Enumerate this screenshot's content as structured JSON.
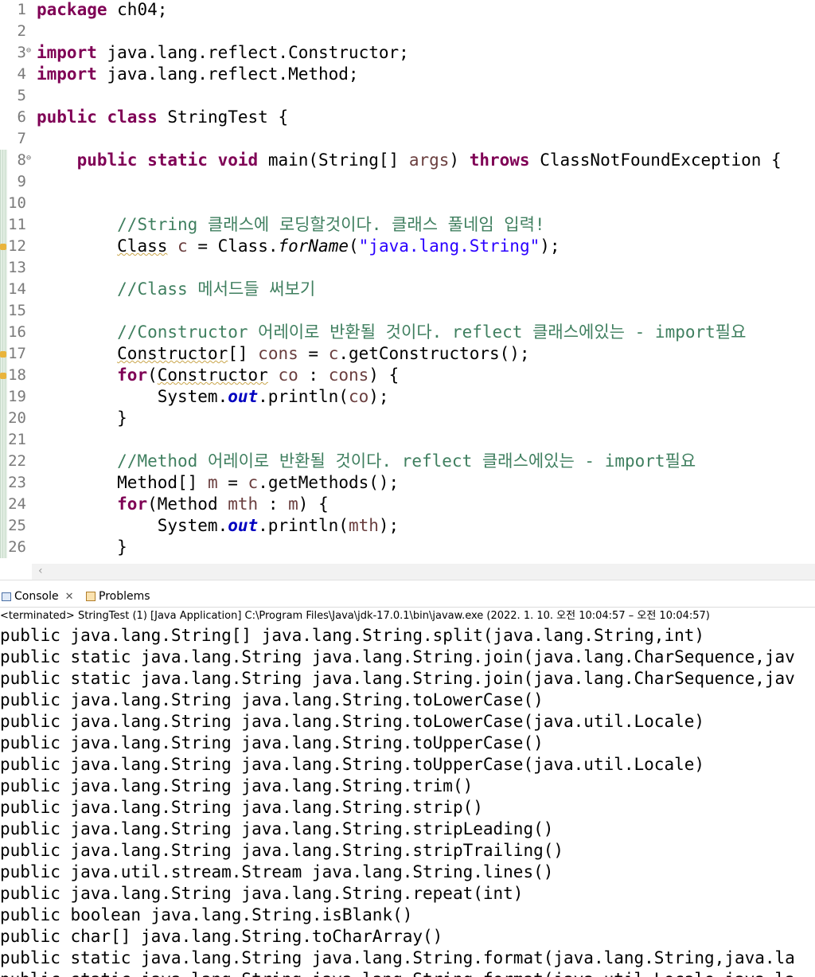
{
  "editor": {
    "line_numbers": [
      "1",
      "2",
      "3",
      "4",
      "5",
      "6",
      "7",
      "8",
      "9",
      "10",
      "11",
      "12",
      "13",
      "14",
      "15",
      "16",
      "17",
      "18",
      "19",
      "20",
      "21",
      "22",
      "23",
      "24",
      "25",
      "26"
    ],
    "lines": [
      [
        {
          "t": "package",
          "c": "kw"
        },
        {
          "t": " ch04;"
        }
      ],
      [],
      [
        {
          "t": "import",
          "c": "kw"
        },
        {
          "t": " java.lang.reflect.Constructor;"
        }
      ],
      [
        {
          "t": "import",
          "c": "kw"
        },
        {
          "t": " java.lang.reflect.Method;"
        }
      ],
      [],
      [
        {
          "t": "public",
          "c": "kw"
        },
        {
          "t": " "
        },
        {
          "t": "class",
          "c": "kw"
        },
        {
          "t": " StringTest {"
        }
      ],
      [],
      [
        {
          "t": "    "
        },
        {
          "t": "public",
          "c": "kw"
        },
        {
          "t": " "
        },
        {
          "t": "static",
          "c": "kw"
        },
        {
          "t": " "
        },
        {
          "t": "void",
          "c": "kw"
        },
        {
          "t": " main(String[] "
        },
        {
          "t": "args",
          "c": "var"
        },
        {
          "t": ") "
        },
        {
          "t": "throws",
          "c": "kw"
        },
        {
          "t": " ClassNotFoundException {"
        }
      ],
      [],
      [],
      [
        {
          "t": "        "
        },
        {
          "t": "//String 클래스에 로딩할것이다. 클래스 풀네임 입력!",
          "c": "cm"
        }
      ],
      [
        {
          "t": "        "
        },
        {
          "t": "Class",
          "c": "squig"
        },
        {
          "t": " "
        },
        {
          "t": "c",
          "c": "var"
        },
        {
          "t": " = Class."
        },
        {
          "t": "forName",
          "c": "sm"
        },
        {
          "t": "("
        },
        {
          "t": "\"java.lang.String\"",
          "c": "st"
        },
        {
          "t": ");"
        }
      ],
      [],
      [
        {
          "t": "        "
        },
        {
          "t": "//Class 메서드들 써보기",
          "c": "cm"
        }
      ],
      [],
      [
        {
          "t": "        "
        },
        {
          "t": "//Constructor 어레이로 반환될 것이다. reflect 클래스에있는 - import필요",
          "c": "cm"
        }
      ],
      [
        {
          "t": "        "
        },
        {
          "t": "Constructor",
          "c": "squig"
        },
        {
          "t": "[] "
        },
        {
          "t": "cons",
          "c": "var"
        },
        {
          "t": " = "
        },
        {
          "t": "c",
          "c": "var"
        },
        {
          "t": ".getConstructors();"
        }
      ],
      [
        {
          "t": "        "
        },
        {
          "t": "for",
          "c": "kw"
        },
        {
          "t": "("
        },
        {
          "t": "Constructor",
          "c": "squig"
        },
        {
          "t": " "
        },
        {
          "t": "co",
          "c": "var"
        },
        {
          "t": " : "
        },
        {
          "t": "cons",
          "c": "var"
        },
        {
          "t": ") {"
        }
      ],
      [
        {
          "t": "            System."
        },
        {
          "t": "out",
          "c": "fld"
        },
        {
          "t": ".println("
        },
        {
          "t": "co",
          "c": "var"
        },
        {
          "t": ");"
        }
      ],
      [
        {
          "t": "        }"
        }
      ],
      [],
      [
        {
          "t": "        "
        },
        {
          "t": "//Method 어레이로 반환될 것이다. reflect 클래스에있는 - import필요",
          "c": "cm"
        }
      ],
      [
        {
          "t": "        Method[] "
        },
        {
          "t": "m",
          "c": "var"
        },
        {
          "t": " = "
        },
        {
          "t": "c",
          "c": "var"
        },
        {
          "t": ".getMethods();"
        }
      ],
      [
        {
          "t": "        "
        },
        {
          "t": "for",
          "c": "kw"
        },
        {
          "t": "(Method "
        },
        {
          "t": "mth",
          "c": "var"
        },
        {
          "t": " : "
        },
        {
          "t": "m",
          "c": "var"
        },
        {
          "t": ") {"
        }
      ],
      [
        {
          "t": "            System."
        },
        {
          "t": "out",
          "c": "fld"
        },
        {
          "t": ".println("
        },
        {
          "t": "mth",
          "c": "var"
        },
        {
          "t": ");"
        }
      ],
      [
        {
          "t": "        }"
        }
      ]
    ]
  },
  "tabs": {
    "console_label": "Console",
    "close_glyph": "✕",
    "problems_label": "Problems"
  },
  "status_text": "<terminated> StringTest (1) [Java Application] C:\\Program Files\\Java\\jdk-17.0.1\\bin\\javaw.exe  (2022. 1. 10. 오전 10:04:57 – 오전 10:04:57)",
  "console_lines": [
    "public java.lang.String[] java.lang.String.split(java.lang.String,int)",
    "public static java.lang.String java.lang.String.join(java.lang.CharSequence,jav",
    "public static java.lang.String java.lang.String.join(java.lang.CharSequence,jav",
    "public java.lang.String java.lang.String.toLowerCase()",
    "public java.lang.String java.lang.String.toLowerCase(java.util.Locale)",
    "public java.lang.String java.lang.String.toUpperCase()",
    "public java.lang.String java.lang.String.toUpperCase(java.util.Locale)",
    "public java.lang.String java.lang.String.trim()",
    "public java.lang.String java.lang.String.strip()",
    "public java.lang.String java.lang.String.stripLeading()",
    "public java.lang.String java.lang.String.stripTrailing()",
    "public java.util.stream.Stream java.lang.String.lines()",
    "public java.lang.String java.lang.String.repeat(int)",
    "public boolean java.lang.String.isBlank()",
    "public char[] java.lang.String.toCharArray()",
    "public static java.lang.String java.lang.String.format(java.lang.String,java.la",
    "public static java.lang.String java.lang.String.format(java.util.Locale,java.la"
  ],
  "colors": {
    "keyword": "#7f0055",
    "comment": "#3f7f5f",
    "string": "#2a00ff",
    "field": "#0000c0",
    "local_var": "#6a3e3e"
  },
  "icons": {
    "fold_marker": "circle-minus-icon",
    "warning": "warning-icon",
    "console": "console-icon",
    "problems": "problems-icon",
    "scroll_left": "chevron-left-icon"
  }
}
